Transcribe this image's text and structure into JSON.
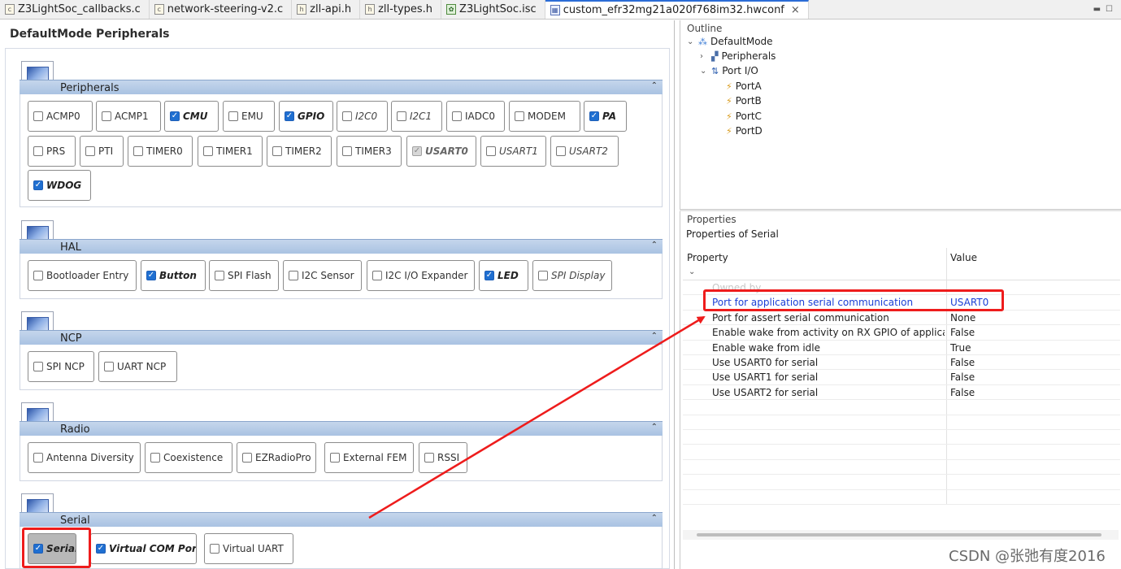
{
  "tabs": [
    {
      "label": "Z3LightSoc_callbacks.c",
      "icon": "c-file-icon"
    },
    {
      "label": "network-steering-v2.c",
      "icon": "c-file-icon"
    },
    {
      "label": "zll-api.h",
      "icon": "h-file-icon"
    },
    {
      "label": "zll-types.h",
      "icon": "h-file-icon"
    },
    {
      "label": "Z3LightSoc.isc",
      "icon": "isc-file-icon"
    },
    {
      "label": "custom_efr32mg21a020f768im32.hwconf",
      "icon": "hwconf-file-icon",
      "close": "×"
    }
  ],
  "left": {
    "title": "DefaultMode Peripherals",
    "sections": {
      "peripherals": {
        "title": "Peripherals",
        "items": [
          "ACMP0",
          "ACMP1",
          "CMU",
          "EMU",
          "GPIO",
          "I2C0",
          "I2C1",
          "IADC0",
          "MODEM",
          "PA",
          "PRS",
          "PTI",
          "TIMER0",
          "TIMER1",
          "TIMER2",
          "TIMER3",
          "USART0",
          "USART1",
          "USART2",
          "WDOG"
        ]
      },
      "hal": {
        "title": "HAL",
        "items": [
          "Bootloader Entry",
          "Button",
          "SPI Flash",
          "I2C Sensor",
          "I2C I/O Expander",
          "LED",
          "SPI Display"
        ]
      },
      "ncp": {
        "title": "NCP",
        "items": [
          "SPI NCP",
          "UART NCP"
        ]
      },
      "radio": {
        "title": "Radio",
        "items": [
          "Antenna Diversity",
          "Coexistence",
          "EZRadioPro",
          "External FEM",
          "RSSI"
        ]
      },
      "serial": {
        "title": "Serial",
        "items": [
          "Serial",
          "Virtual COM Port",
          "Virtual UART"
        ]
      }
    }
  },
  "outline": {
    "title": "Outline",
    "root": "DefaultMode",
    "peripherals": "Peripherals",
    "portio": "Port I/O",
    "ports": [
      "PortA",
      "PortB",
      "PortC",
      "PortD"
    ]
  },
  "properties": {
    "title": "Properties",
    "subtitle": "Properties of Serial",
    "col_property": "Property",
    "col_value": "Value",
    "ghost_row": "Owned by",
    "rows": [
      {
        "key": "Port for application serial communication",
        "value": "USART0"
      },
      {
        "key": "Port for assert serial communication",
        "value": "None"
      },
      {
        "key": "Enable wake from activity on RX GPIO of application",
        "value": "False"
      },
      {
        "key": "Enable wake from idle",
        "value": "True"
      },
      {
        "key": "Use USART0 for serial",
        "value": "False"
      },
      {
        "key": "Use USART1 for serial",
        "value": "False"
      },
      {
        "key": "Use USART2 for serial",
        "value": "False"
      }
    ]
  },
  "watermark": "CSDN @张弛有度2016",
  "colors": {
    "highlight": "#ee1c1c",
    "checked": "#1f6fd1",
    "link": "#1a3fd6"
  }
}
